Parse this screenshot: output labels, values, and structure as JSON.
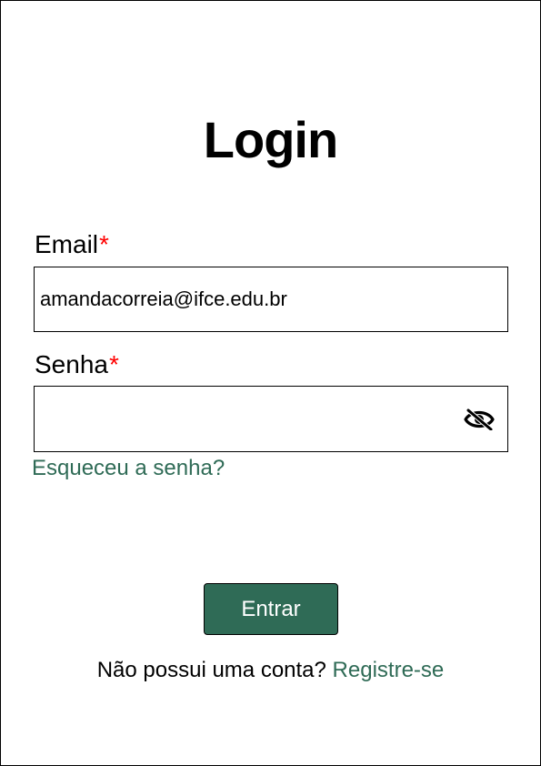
{
  "page": {
    "title": "Login"
  },
  "form": {
    "email_label": "Email",
    "email_required_mark": "*",
    "email_value": "amandacorreia@ifce.edu.br",
    "password_label": "Senha",
    "password_required_mark": "*",
    "password_value": "",
    "password_toggle_icon": "eye-off-icon",
    "forgot_link": "Esqueceu a senha?",
    "submit_label": "Entrar"
  },
  "footer": {
    "prompt": "Não possui uma conta?",
    "register_link": "Registre-se"
  },
  "colors": {
    "accent": "#2f6b56",
    "required": "#ff0000",
    "border": "#000000"
  }
}
